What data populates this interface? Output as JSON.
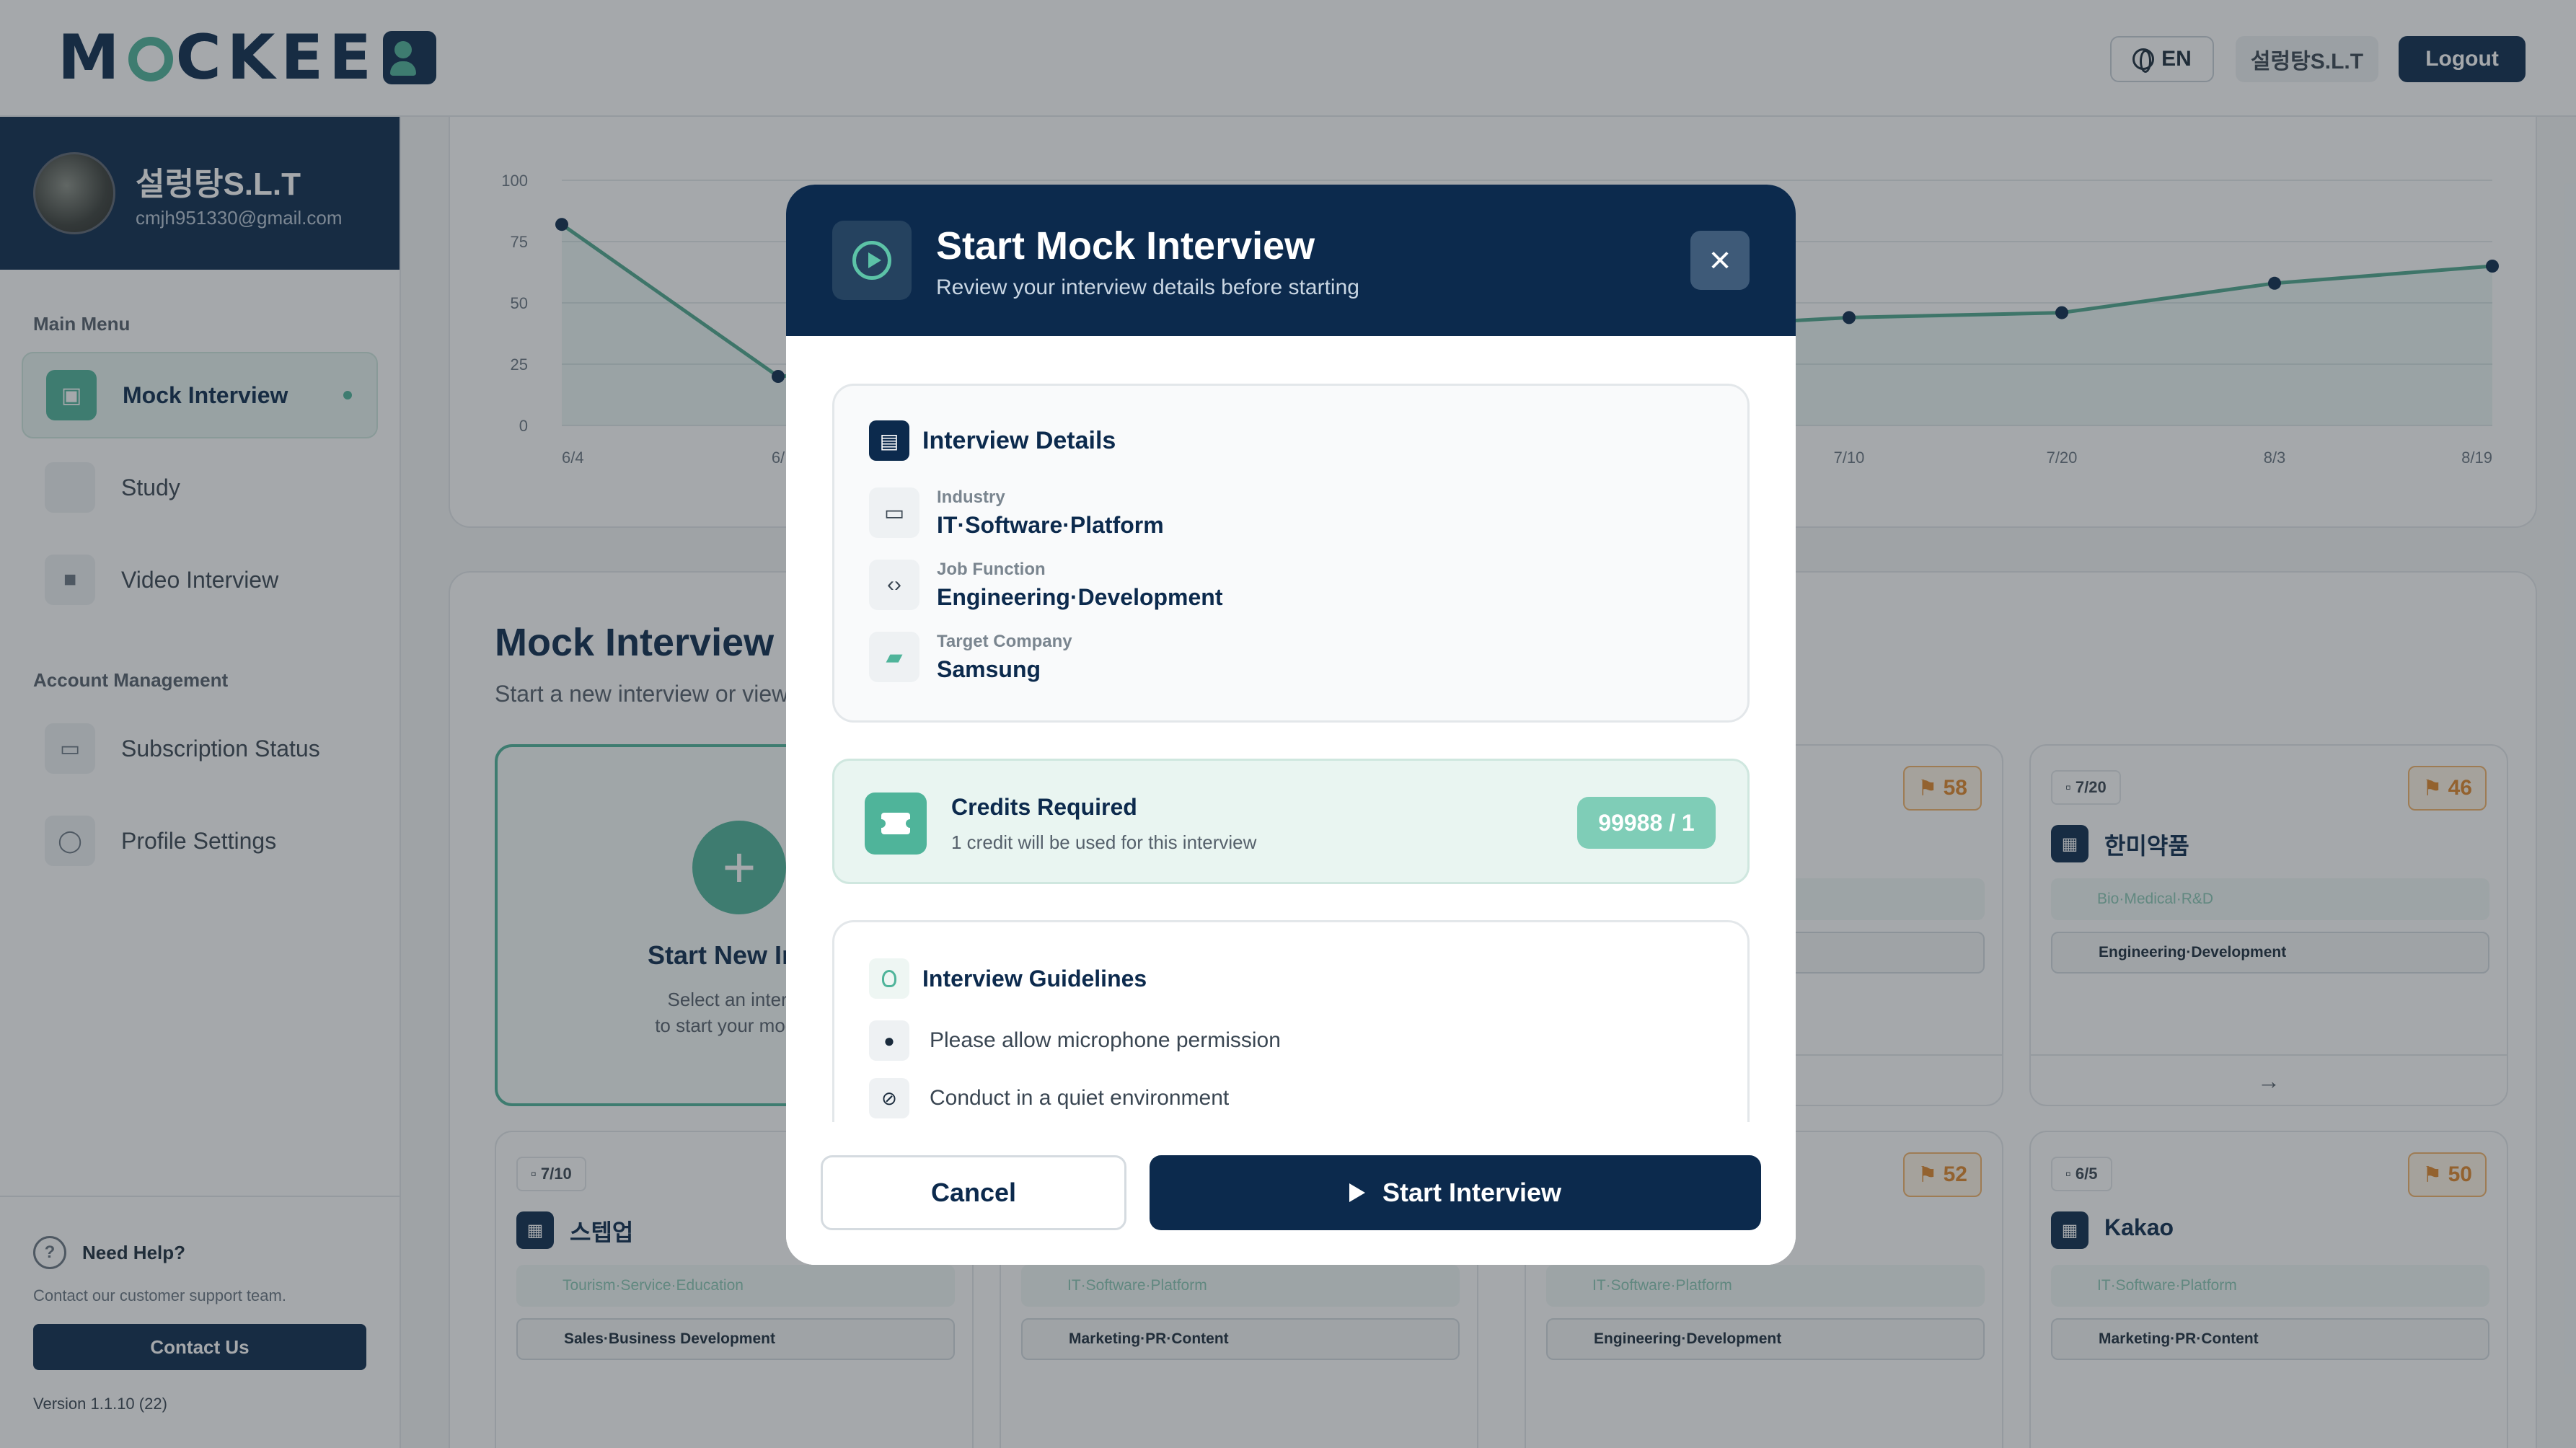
{
  "header": {
    "logo_text": "MOCKEE",
    "language": "EN",
    "user_name": "설렁탕S.L.T",
    "logout_label": "Logout"
  },
  "sidebar": {
    "profile": {
      "name": "설렁탕S.L.T",
      "email": "cmjh951330@gmail.com"
    },
    "main_menu_label": "Main Menu",
    "main_items": [
      {
        "label": "Mock Interview",
        "icon": "interview-icon",
        "active": true
      },
      {
        "label": "Study",
        "icon": "study-icon",
        "active": false
      },
      {
        "label": "Video Interview",
        "icon": "video-icon",
        "active": false
      }
    ],
    "account_label": "Account Management",
    "account_items": [
      {
        "label": "Subscription Status",
        "icon": "monitor-icon"
      },
      {
        "label": "Profile Settings",
        "icon": "user-icon"
      }
    ],
    "help": {
      "title": "Need Help?",
      "desc": "Contact our customer support team.",
      "contact_label": "Contact Us",
      "version": "Version 1.1.10 (22)"
    }
  },
  "chart_data": {
    "type": "line",
    "y_ticks": [
      "100",
      "75",
      "50",
      "25",
      "0"
    ],
    "ylim": [
      0,
      100
    ],
    "x_labels": [
      "6/4",
      "6/",
      "7/10",
      "7/20",
      "8/3",
      "8/19"
    ],
    "points": [
      {
        "x": "6/4",
        "y": 82
      },
      {
        "x": "6/",
        "y": 20
      },
      {
        "x": "7/10",
        "y": 44
      },
      {
        "x": "7/20",
        "y": 46
      },
      {
        "x": "8/3",
        "y": 58
      },
      {
        "x": "8/19",
        "y": 65
      }
    ]
  },
  "main": {
    "section_title": "Mock Interview",
    "section_sub": "Start a new interview or view p",
    "new_card": {
      "title": "Start New Inte",
      "desc_line1": "Select an intervi",
      "desc_line2": "to start your mock i"
    },
    "cards": [
      {
        "date": "",
        "score": "58",
        "company": "",
        "industry": "",
        "job": ""
      },
      {
        "date": "7/20",
        "score": "46",
        "company": "한미약품",
        "industry": "Bio·Medical·R&D",
        "job": "Engineering·Development"
      },
      {
        "date": "7/10",
        "score": "",
        "company": "스텝업",
        "industry": "Tourism·Service·Education",
        "job": "Sales·Business Development"
      },
      {
        "date": "",
        "score": "",
        "company": "",
        "industry": "IT·Software·Platform",
        "job": "Marketing·PR·Content"
      },
      {
        "date": "",
        "score": "52",
        "company": "",
        "industry": "IT·Software·Platform",
        "job": "Engineering·Development"
      },
      {
        "date": "6/5",
        "score": "50",
        "company": "Kakao",
        "industry": "IT·Software·Platform",
        "job": "Marketing·PR·Content"
      }
    ]
  },
  "modal": {
    "title": "Start Mock Interview",
    "subtitle": "Review your interview details before starting",
    "details": {
      "title": "Interview Details",
      "industry_label": "Industry",
      "industry_value": "IT·Software·Platform",
      "job_label": "Job Function",
      "job_value": "Engineering·Development",
      "company_label": "Target Company",
      "company_value": "Samsung"
    },
    "credits": {
      "title": "Credits Required",
      "desc": "1 credit will be used for this interview",
      "badge": "99988 / 1"
    },
    "guidelines": {
      "title": "Interview Guidelines",
      "items": [
        "Please allow microphone permission",
        "Conduct in a quiet environment"
      ]
    },
    "cancel_label": "Cancel",
    "start_label": "Start Interview"
  },
  "colors": {
    "navy": "#0c2a4d",
    "accent": "#4fb49a",
    "score": "#e0872a"
  }
}
